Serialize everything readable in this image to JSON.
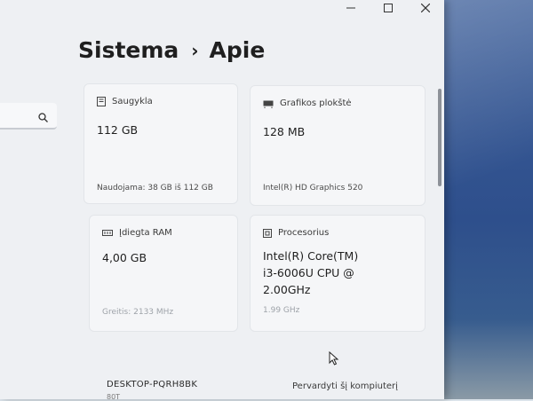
{
  "window": {
    "controls": [
      "minimize",
      "maximize",
      "close"
    ]
  },
  "sidebar": {
    "search_icon": "search-icon"
  },
  "breadcrumb": {
    "parent": "Sistema",
    "separator": "›",
    "current": "Apie"
  },
  "cards": {
    "storage": {
      "title": "Saugykla",
      "icon": "storage-icon",
      "value": "112 GB",
      "sub": "Naudojama: 38 GB iš 112 GB"
    },
    "graphics": {
      "title": "Grafikos plokštė",
      "icon": "gpu-icon",
      "value": "128 MB",
      "sub": "Intel(R) HD Graphics 520"
    },
    "ram": {
      "title": "Įdiegta RAM",
      "icon": "ram-icon",
      "value": "4,00 GB",
      "sub": "Greitis: 2133 MHz"
    },
    "processor": {
      "title": "Procesorius",
      "icon": "cpu-icon",
      "value_line1": "Intel(R) Core(TM)",
      "value_line2": "i3-6006U CPU @",
      "value_line3": "2.00GHz",
      "sub": "1.99 GHz"
    }
  },
  "footer": {
    "device_name": "DESKTOP-PQRH8BK",
    "device_sub": "80T",
    "rename_button": "Pervardyti šį kompiuterį"
  },
  "colors": {
    "window_bg": "#eef0f3",
    "card_bg": "#f5f6f8",
    "desktop_bg": "#2e4f8c"
  }
}
